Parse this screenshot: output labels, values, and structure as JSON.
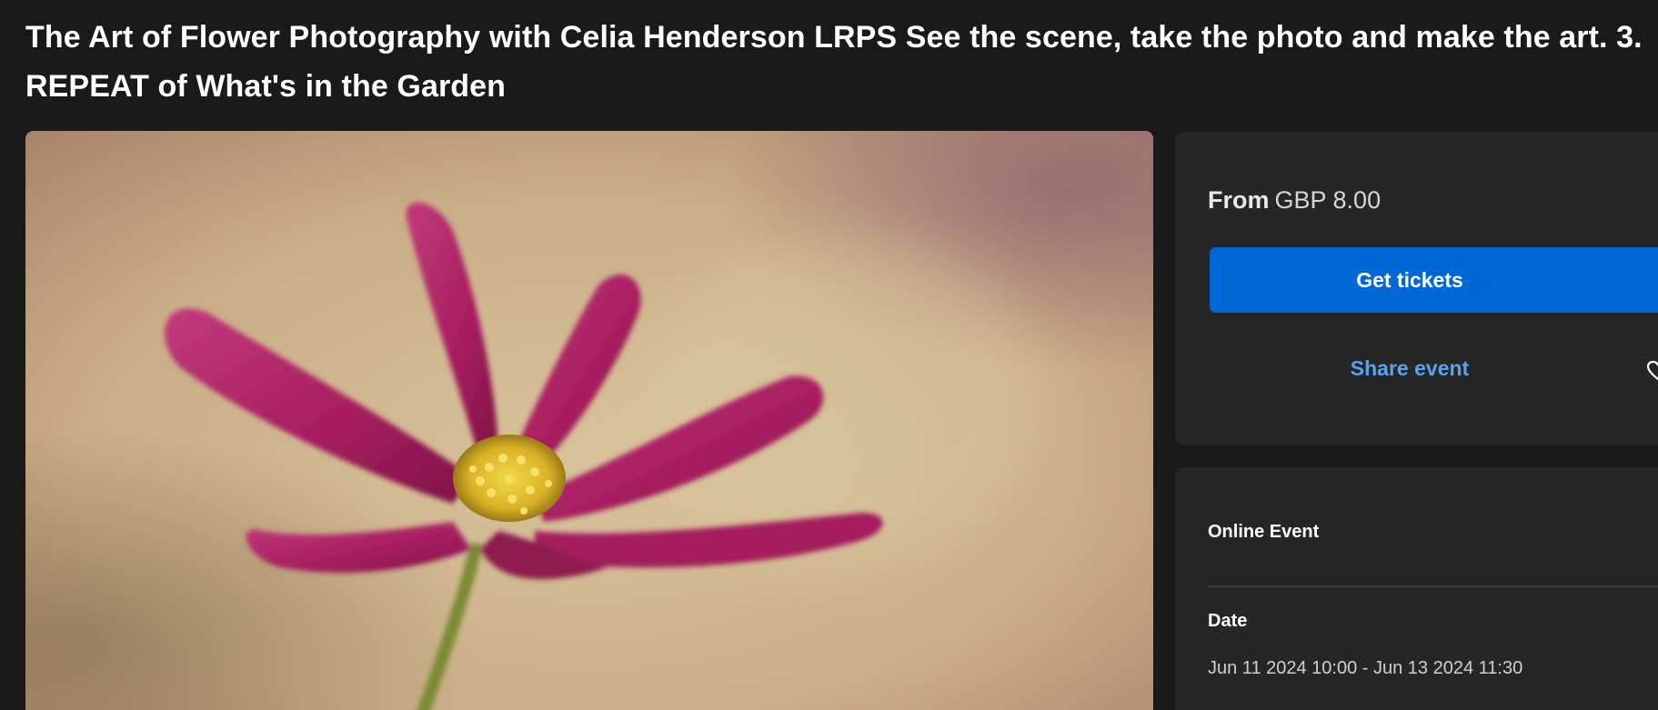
{
  "event": {
    "title": "The Art of Flower Photography with Celia Henderson LRPS See the scene, take the photo and make the art. 3. REPEAT of What's in the Garden"
  },
  "hero_image": {
    "alt": "pink cosmos flower",
    "icon": "cosmos-flower"
  },
  "pricing": {
    "from_label": "From",
    "price": "GBP 8.00",
    "tickets_button": "Get tickets",
    "share_label": "Share event",
    "favorite_icon": "heart-icon"
  },
  "details": {
    "event_type": "Online Event",
    "date_label": "Date",
    "date_value": "Jun 11 2024 10:00 - Jun 13 2024 11:30"
  },
  "colors": {
    "background": "#1a1a1a",
    "card": "#262626",
    "accent": "#0068d6",
    "link": "#5aa2ee"
  }
}
